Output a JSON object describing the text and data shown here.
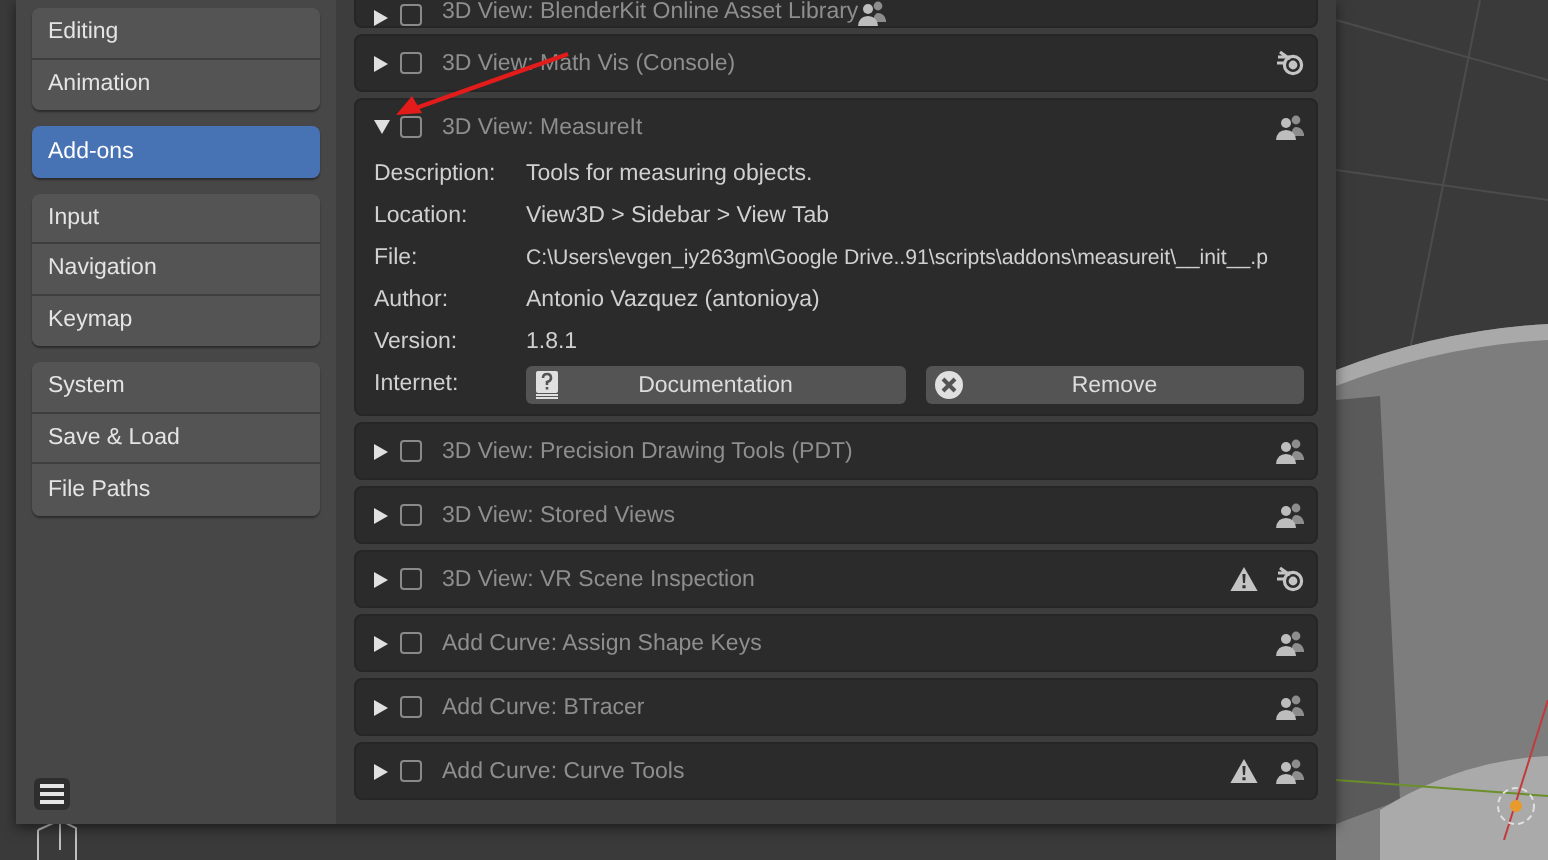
{
  "sidebar": {
    "groups": [
      {
        "items": [
          {
            "label": "Editing",
            "selected": false
          },
          {
            "label": "Animation",
            "selected": false
          }
        ]
      },
      {
        "items": [
          {
            "label": "Add-ons",
            "selected": true
          }
        ]
      },
      {
        "items": [
          {
            "label": "Input",
            "selected": false
          },
          {
            "label": "Navigation",
            "selected": false
          },
          {
            "label": "Keymap",
            "selected": false
          }
        ]
      },
      {
        "items": [
          {
            "label": "System",
            "selected": false
          },
          {
            "label": "Save & Load",
            "selected": false
          },
          {
            "label": "File Paths",
            "selected": false
          }
        ]
      }
    ]
  },
  "addons": [
    {
      "name": "3D View: BlenderKit Online Asset Library",
      "expanded": false,
      "enabled": false,
      "icons": [
        {
          "kind": "community"
        }
      ]
    },
    {
      "name": "3D View: Math Vis (Console)",
      "expanded": false,
      "enabled": false,
      "icons": [
        {
          "kind": "official"
        }
      ]
    },
    {
      "name": "3D View: MeasureIt",
      "expanded": true,
      "enabled": false,
      "icons": [
        {
          "kind": "community"
        }
      ],
      "details": [
        {
          "label": "Description:",
          "value": "Tools for measuring objects."
        },
        {
          "label": "Location:",
          "value": "View3D > Sidebar > View Tab"
        },
        {
          "label": "File:",
          "value": "C:\\Users\\evgen_iy263gm\\Google Drive..91\\scripts\\addons\\measureit\\__init__.p"
        },
        {
          "label": "Author:",
          "value": "Antonio Vazquez (antonioya)"
        },
        {
          "label": "Version:",
          "value": "1.8.1"
        }
      ],
      "internet": {
        "label": "Internet:",
        "buttons": [
          {
            "kind": "documentation",
            "label": "Documentation"
          },
          {
            "kind": "remove",
            "label": "Remove"
          }
        ]
      }
    },
    {
      "name": "3D View: Precision Drawing Tools (PDT)",
      "expanded": false,
      "enabled": false,
      "icons": [
        {
          "kind": "community"
        }
      ]
    },
    {
      "name": "3D View: Stored Views",
      "expanded": false,
      "enabled": false,
      "icons": [
        {
          "kind": "community"
        }
      ]
    },
    {
      "name": "3D View: VR Scene Inspection",
      "expanded": false,
      "enabled": false,
      "icons": [
        {
          "kind": "warning"
        },
        {
          "kind": "official"
        }
      ]
    },
    {
      "name": "Add Curve: Assign Shape Keys",
      "expanded": false,
      "enabled": false,
      "icons": [
        {
          "kind": "community"
        }
      ]
    },
    {
      "name": "Add Curve: BTracer",
      "expanded": false,
      "enabled": false,
      "icons": [
        {
          "kind": "community"
        }
      ]
    },
    {
      "name": "Add Curve: Curve Tools",
      "expanded": false,
      "enabled": false,
      "icons": [
        {
          "kind": "warning"
        },
        {
          "kind": "community"
        }
      ]
    }
  ]
}
